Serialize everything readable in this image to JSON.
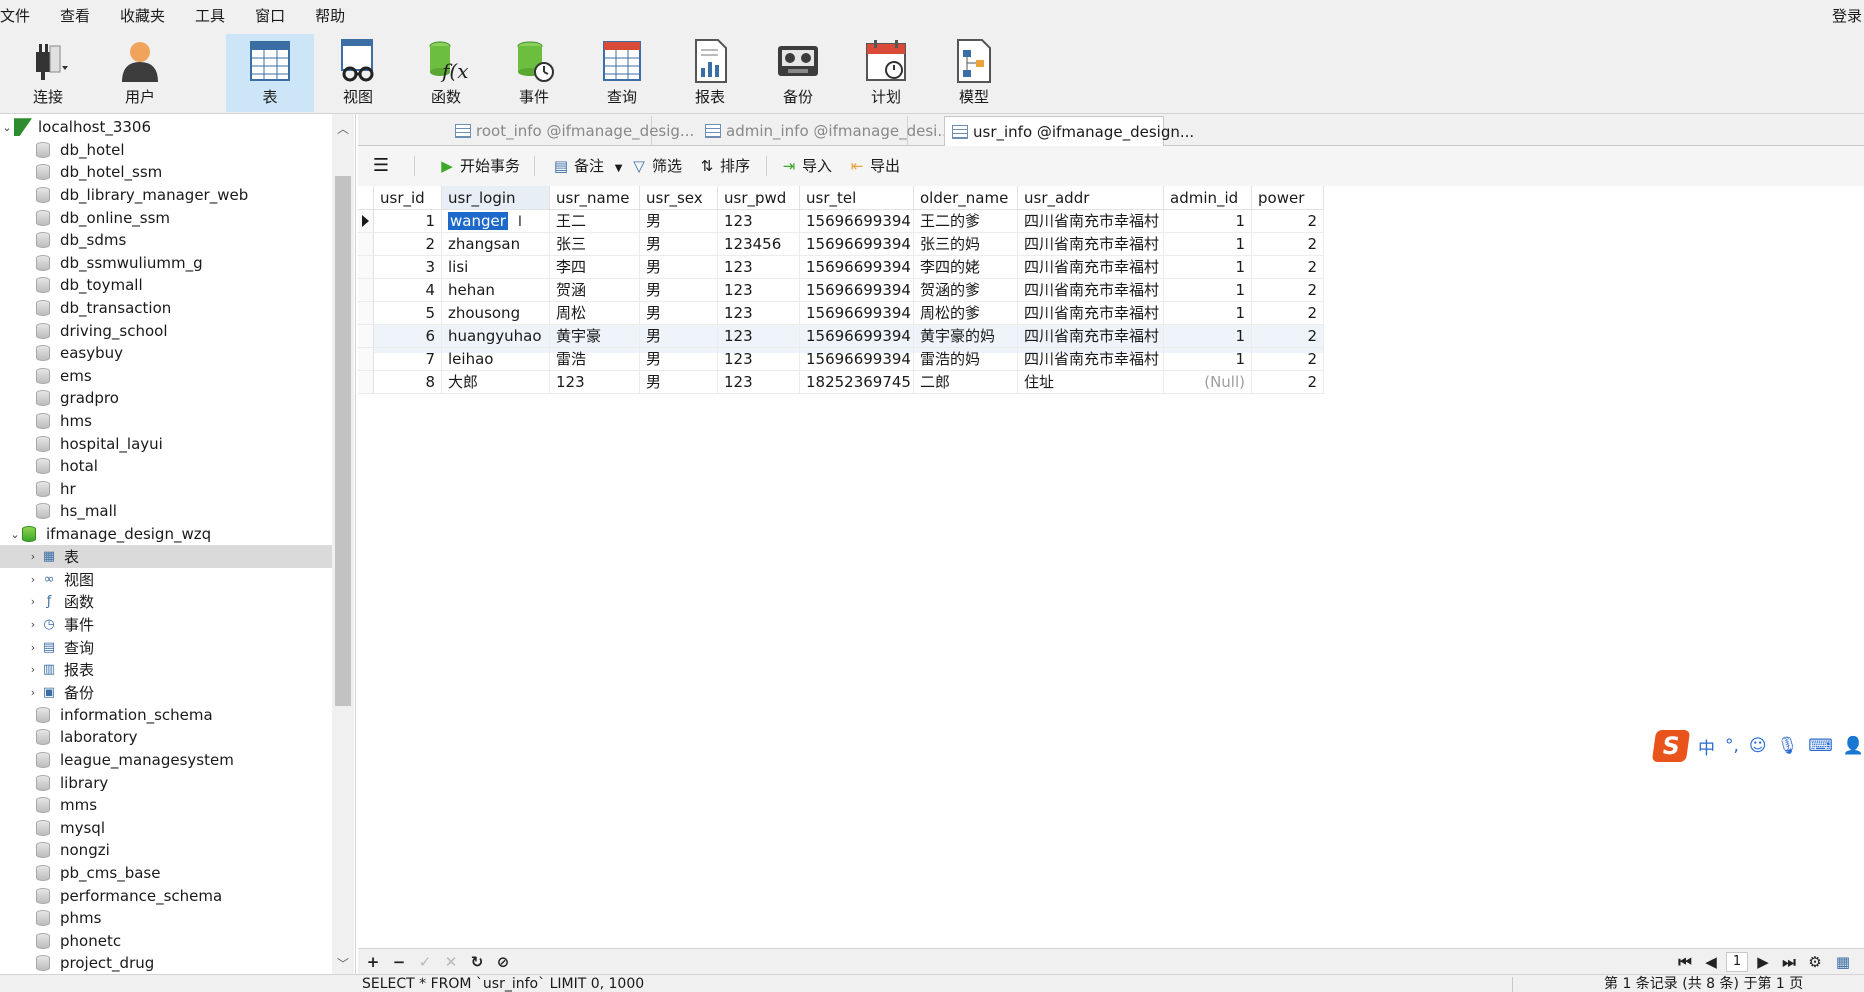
{
  "menubar": {
    "items": [
      "文件",
      "查看",
      "收藏夹",
      "工具",
      "窗口",
      "帮助"
    ],
    "login": "登录"
  },
  "toolbar": {
    "buttons": [
      {
        "label": "连接",
        "icon": "plug-icon"
      },
      {
        "label": "用户",
        "icon": "user-icon"
      },
      {
        "label": "表",
        "icon": "table-icon"
      },
      {
        "label": "视图",
        "icon": "view-icon"
      },
      {
        "label": "函数",
        "icon": "function-icon"
      },
      {
        "label": "事件",
        "icon": "event-icon"
      },
      {
        "label": "查询",
        "icon": "query-icon"
      },
      {
        "label": "报表",
        "icon": "report-icon"
      },
      {
        "label": "备份",
        "icon": "backup-icon"
      },
      {
        "label": "计划",
        "icon": "schedule-icon"
      },
      {
        "label": "模型",
        "icon": "model-icon"
      }
    ],
    "active": "表"
  },
  "sidebar": {
    "connection": "localhost_3306",
    "databases_before": [
      "db_hotel",
      "db_hotel_ssm",
      "db_library_manager_web",
      "db_online_ssm",
      "db_sdms",
      "db_ssmwuliumm_g",
      "db_toymall",
      "db_transaction",
      "driving_school",
      "easybuy",
      "ems",
      "gradpro",
      "hms",
      "hospital_layui",
      "hotal",
      "hr",
      "hs_mall"
    ],
    "open_database": "ifmanage_design_wzq",
    "open_database_children": [
      "表",
      "视图",
      "函数",
      "事件",
      "查询",
      "报表",
      "备份"
    ],
    "databases_after": [
      "information_schema",
      "laboratory",
      "league_managesystem",
      "library",
      "mms",
      "mysql",
      "nongzi",
      "pb_cms_base",
      "performance_schema",
      "phms",
      "phonetc",
      "project_drug"
    ]
  },
  "tabs": [
    {
      "label": "root_info @ifmanage_desig...",
      "active": false
    },
    {
      "label": "admin_info @ifmanage_desi...",
      "active": false
    },
    {
      "label": "usr_info @ifmanage_design...",
      "active": true
    }
  ],
  "datatools": {
    "begin_transaction": "开始事务",
    "memo": "备注",
    "filter": "筛选",
    "sort": "排序",
    "import": "导入",
    "export": "导出"
  },
  "grid": {
    "columns": [
      "usr_id",
      "usr_login",
      "usr_name",
      "usr_sex",
      "usr_pwd",
      "usr_tel",
      "older_name",
      "usr_addr",
      "admin_id",
      "power"
    ],
    "rows": [
      [
        "1",
        "wanger",
        "王二",
        "男",
        "123",
        "15696699394",
        "王二的爹",
        "四川省南充市幸福村",
        "1",
        "2"
      ],
      [
        "2",
        "zhangsan",
        "张三",
        "男",
        "123456",
        "15696699394",
        "张三的妈",
        "四川省南充市幸福村",
        "1",
        "2"
      ],
      [
        "3",
        "lisi",
        "李四",
        "男",
        "123",
        "15696699394",
        "李四的姥",
        "四川省南充市幸福村",
        "1",
        "2"
      ],
      [
        "4",
        "hehan",
        "贺涵",
        "男",
        "123",
        "15696699394",
        "贺涵的爹",
        "四川省南充市幸福村",
        "1",
        "2"
      ],
      [
        "5",
        "zhousong",
        "周松",
        "男",
        "123",
        "15696699394",
        "周松的爹",
        "四川省南充市幸福村",
        "1",
        "2"
      ],
      [
        "6",
        "huangyuhao",
        "黄宇豪",
        "男",
        "123",
        "15696699394",
        "黄宇豪的妈",
        "四川省南充市幸福村",
        "1",
        "2"
      ],
      [
        "7",
        "leihao",
        "雷浩",
        "男",
        "123",
        "15696699394",
        "雷浩的妈",
        "四川省南充市幸福村",
        "1",
        "2"
      ],
      [
        "8",
        "大郎",
        "123",
        "男",
        "123",
        "18252369745",
        "二郎",
        "住址",
        "(Null)",
        "2"
      ]
    ]
  },
  "bottombar": {
    "page": "1"
  },
  "status": {
    "sql": "SELECT * FROM `usr_info` LIMIT 0, 1000",
    "records": "第 1 条记录 (共 8 条) 于第 1 页"
  },
  "ime": {
    "logo": "S",
    "mode": "中"
  }
}
